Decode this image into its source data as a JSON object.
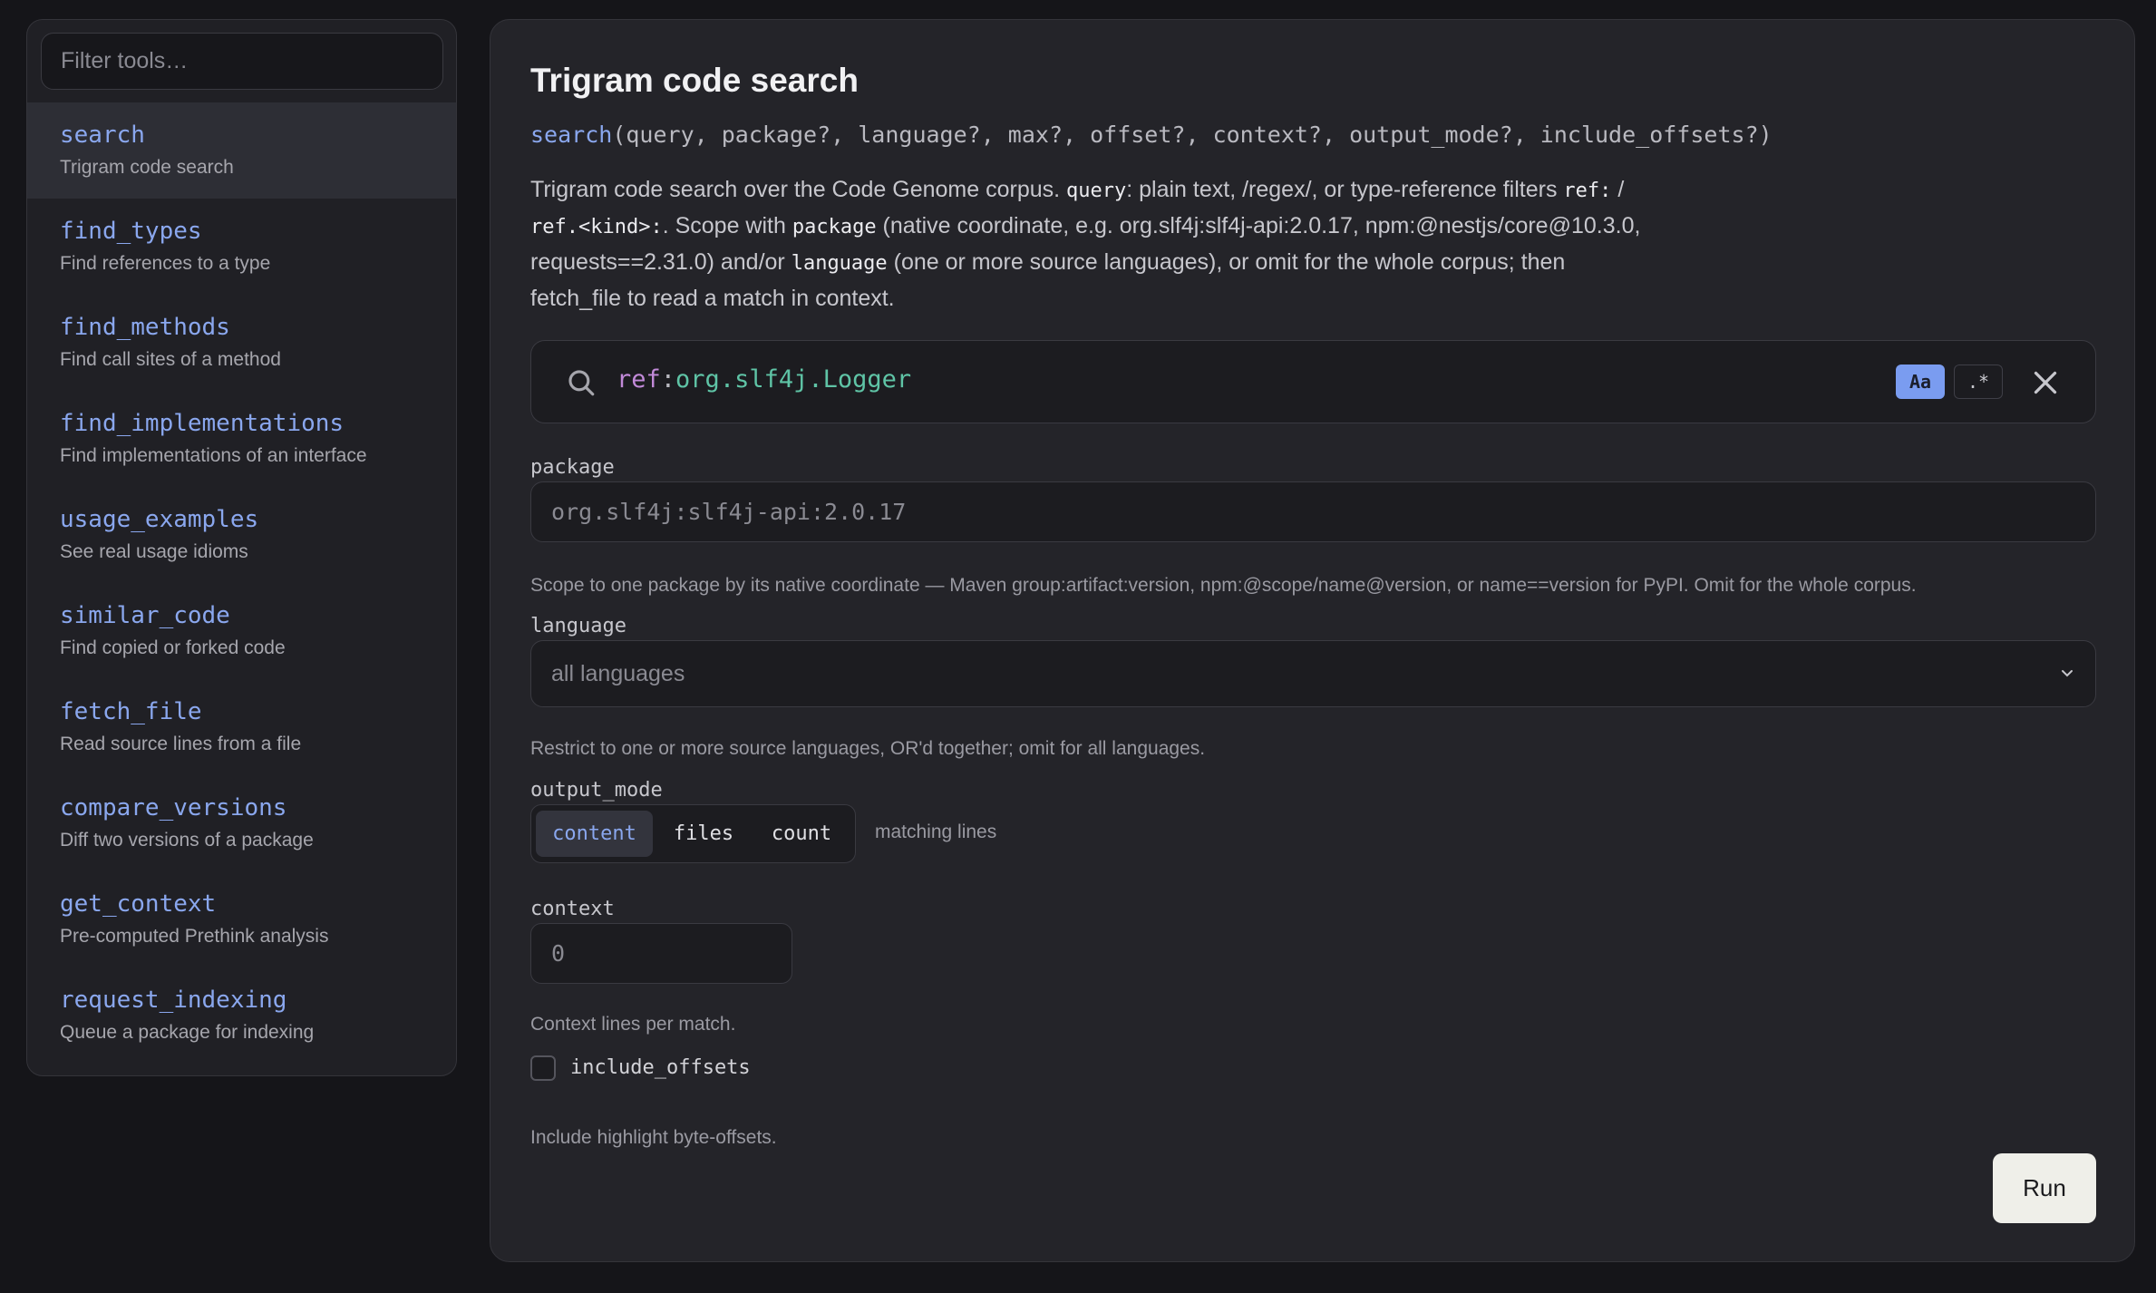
{
  "sidebar": {
    "filter_placeholder": "Filter tools…",
    "tools": [
      {
        "name": "search",
        "desc": "Trigram code search"
      },
      {
        "name": "find_types",
        "desc": "Find references to a type"
      },
      {
        "name": "find_methods",
        "desc": "Find call sites of a method"
      },
      {
        "name": "find_implementations",
        "desc": "Find implementations of an interface"
      },
      {
        "name": "usage_examples",
        "desc": "See real usage idioms"
      },
      {
        "name": "similar_code",
        "desc": "Find copied or forked code"
      },
      {
        "name": "fetch_file",
        "desc": "Read source lines from a file"
      },
      {
        "name": "compare_versions",
        "desc": "Diff two versions of a package"
      },
      {
        "name": "get_context",
        "desc": "Pre-computed Prethink analysis"
      },
      {
        "name": "request_indexing",
        "desc": "Queue a package for indexing"
      }
    ]
  },
  "main": {
    "title": "Trigram code search",
    "signature_fn": "search",
    "signature_args": "(query, package?, language?, max?, offset?, context?, output_mode?, include_offsets?)",
    "desc": {
      "t1": "Trigram code search over the Code Genome corpus. ",
      "c1": "query",
      "t2": ": plain text, /regex/, or type-reference filters ",
      "c2": "ref:",
      "t3": " / ",
      "c3": "ref.<kind>:",
      "t4": ". Scope with ",
      "c4": "package",
      "t5": " (native coordinate, e.g. org.slf4j:slf4j-api:2.0.17, npm:@nestjs/core@10.3.0, requests==2.31.0) and/or ",
      "c5": "language",
      "t6": " (one or more source languages), or omit for the whole corpus; then fetch_file to read a match in context."
    },
    "query": {
      "prefix": "ref",
      "colon": ":",
      "value": "org.slf4j.Logger"
    },
    "case_toggle": "Aa",
    "regex_toggle": ".*",
    "package": {
      "label": "package",
      "placeholder": "org.slf4j:slf4j-api:2.0.17",
      "hint": "Scope to one package by its native coordinate — Maven group:artifact:version, npm:@scope/name@version, or name==version for PyPI. Omit for the whole corpus."
    },
    "language": {
      "label": "language",
      "value": "all languages",
      "hint": "Restrict to one or more source languages, OR'd together; omit for all languages."
    },
    "output_mode": {
      "label": "output_mode",
      "options": [
        "content",
        "files",
        "count"
      ],
      "selected": "content",
      "note": "matching lines"
    },
    "context": {
      "label": "context",
      "placeholder": "0",
      "hint": "Context lines per match."
    },
    "include_offsets": {
      "label": "include_offsets",
      "checked": false,
      "hint": "Include highlight byte-offsets."
    },
    "run_label": "Run"
  }
}
